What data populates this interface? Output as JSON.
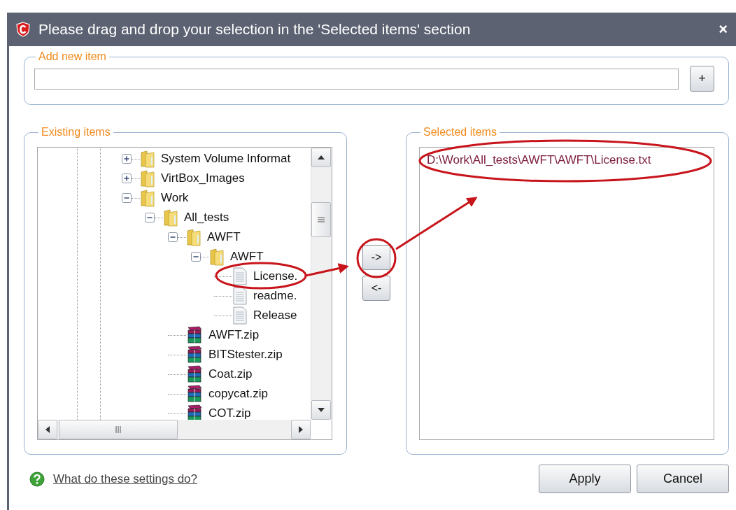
{
  "window": {
    "title": "Please drag and drop your selection in the 'Selected items' section",
    "close": "×"
  },
  "add_new_item": {
    "legend": "Add new item",
    "add_button": "+"
  },
  "existing_items": {
    "legend": "Existing items",
    "tree": [
      {
        "label": "System Volume Informat",
        "kind": "folder",
        "expanded": false
      },
      {
        "label": "VirtBox_Images",
        "kind": "folder",
        "expanded": false
      },
      {
        "label": "Work",
        "kind": "folder",
        "expanded": true,
        "children": [
          {
            "label": "All_tests",
            "kind": "folder",
            "expanded": true,
            "children": [
              {
                "label": "AWFT",
                "kind": "folder",
                "expanded": true,
                "children": [
                  {
                    "label": "AWFT",
                    "kind": "folder",
                    "expanded": true,
                    "children": [
                      {
                        "label": "License.",
                        "kind": "file"
                      },
                      {
                        "label": "readme.",
                        "kind": "file"
                      },
                      {
                        "label": "Release",
                        "kind": "file"
                      }
                    ]
                  }
                ]
              },
              {
                "label": "AWFT.zip",
                "kind": "zip"
              },
              {
                "label": "BITStester.zip",
                "kind": "zip"
              },
              {
                "label": "Coat.zip",
                "kind": "zip"
              },
              {
                "label": "copycat.zip",
                "kind": "zip"
              },
              {
                "label": "COT.zip",
                "kind": "zip"
              }
            ]
          }
        ]
      }
    ]
  },
  "move_buttons": [
    "->",
    "<-"
  ],
  "selected_items": {
    "legend": "Selected items",
    "items": [
      {
        "path": "D:\\Work\\All_tests\\AWFT\\AWFT\\License.txt"
      }
    ]
  },
  "help_link": "What do these settings do?",
  "buttons": [
    "Apply",
    "Cancel"
  ]
}
